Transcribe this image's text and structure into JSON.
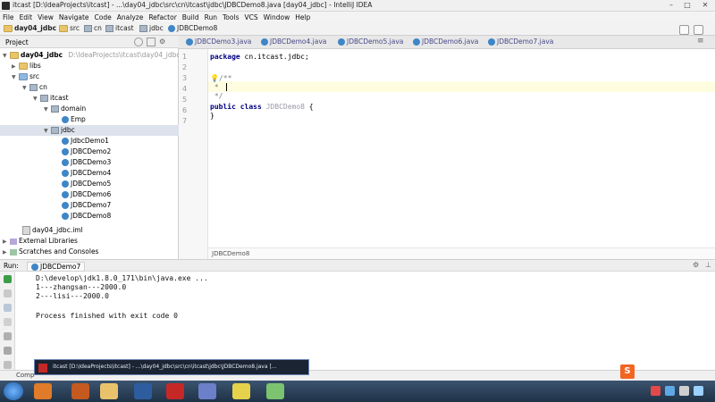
{
  "window": {
    "title": "itcast [D:\\IdeaProjects\\itcast] - ...\\day04_jdbc\\src\\cn\\itcast\\jdbc\\JDBCDemo8.java [day04_jdbc] - IntelliJ IDEA",
    "minimize": "–",
    "maximize": "□",
    "close": "✕"
  },
  "menu": [
    "File",
    "Edit",
    "View",
    "Navigate",
    "Code",
    "Analyze",
    "Refactor",
    "Build",
    "Run",
    "Tools",
    "VCS",
    "Window",
    "Help"
  ],
  "breadcrumbs": [
    "day04_jdbc",
    "src",
    "cn",
    "itcast",
    "jdbc",
    "JDBCDemo8"
  ],
  "project_panel": {
    "title": "Project",
    "tree": [
      {
        "label": "day04_jdbc",
        "hint": "D:\\IdeaProjects\\itcast\\day04_jdbc"
      },
      {
        "label": "libs"
      },
      {
        "label": "src"
      },
      {
        "label": "cn"
      },
      {
        "label": "itcast"
      },
      {
        "label": "domain"
      },
      {
        "label": "Emp"
      },
      {
        "label": "jdbc"
      },
      {
        "label": "JdbcDemo1"
      },
      {
        "label": "JDBCDemo2"
      },
      {
        "label": "JDBCDemo3"
      },
      {
        "label": "JDBCDemo4"
      },
      {
        "label": "JDBCDemo5"
      },
      {
        "label": "JDBCDemo6"
      },
      {
        "label": "JDBCDemo7"
      },
      {
        "label": "JDBCDemo8"
      },
      {
        "label": "day04_jdbc.iml"
      },
      {
        "label": "External Libraries"
      },
      {
        "label": "Scratches and Consoles"
      }
    ]
  },
  "editor": {
    "tabs": [
      "JDBCDemo3.java",
      "JDBCDemo4.java",
      "JDBCDemo5.java",
      "JDBCDemo6.java",
      "JDBCDemo7.java"
    ],
    "line_numbers": [
      "1",
      "2",
      "3",
      "4",
      "5",
      "6",
      "7"
    ],
    "code": {
      "l1_kw": "package",
      "l1_rest": " cn.itcast.jdbc;",
      "l3": "/**",
      "l4": " *",
      "l5": " */",
      "l6_kw": "public class",
      "l6_name": " JDBCDemo8",
      "l6_brace": " {",
      "l7": "}"
    },
    "footer": "JDBCDemo8"
  },
  "run_panel": {
    "label": "Run:",
    "tab": "JDBCDemo7",
    "console": [
      "D:\\develop\\jdk1.8.0_171\\bin\\java.exe ...",
      "1---zhangsan---2000.0",
      "2---lisi---2000.0",
      "",
      "Process finished with exit code 0"
    ]
  },
  "status": {
    "text": "Comp"
  },
  "popup": {
    "text": "itcast [D:\\IdeaProjects\\itcast] - ...\\day04_jdbc\\src\\cn\\itcast\\jdbc\\JDBCDemo8.java [..."
  },
  "taskbar": {
    "ime": "S",
    "ime_icon": "sogou-icon"
  }
}
